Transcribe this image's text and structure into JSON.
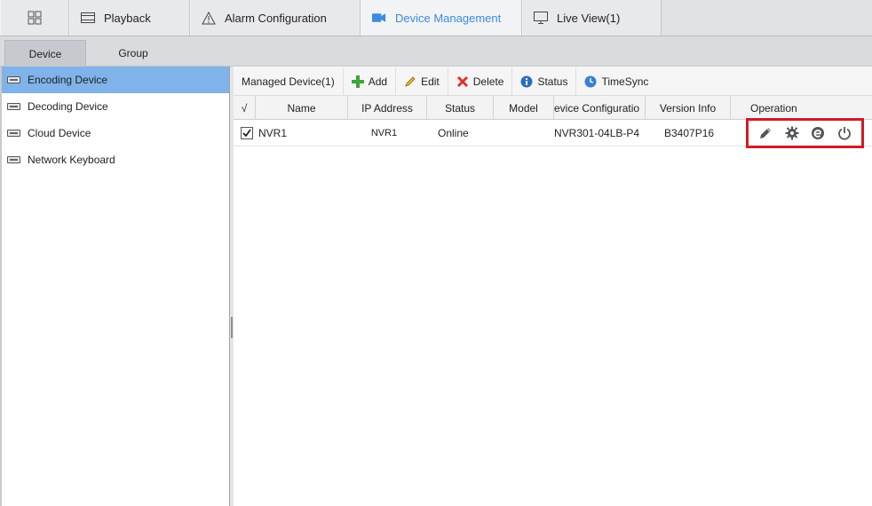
{
  "top_tabs": [
    {
      "label": "",
      "icon": "grid-icon"
    },
    {
      "label": "Playback",
      "icon": "playback-icon"
    },
    {
      "label": "Alarm Configuration",
      "icon": "alarm-icon"
    },
    {
      "label": "Device Management",
      "icon": "camera-icon",
      "active": true
    },
    {
      "label": "Live View(1)",
      "icon": "monitor-icon"
    }
  ],
  "sub_tabs": [
    {
      "label": "Device",
      "active": true
    },
    {
      "label": "Group"
    }
  ],
  "left_tree": [
    {
      "label": "Encoding Device",
      "selected": true
    },
    {
      "label": "Decoding Device"
    },
    {
      "label": "Cloud Device"
    },
    {
      "label": "Network Keyboard"
    }
  ],
  "toolbar": {
    "managed": "Managed Device(1)",
    "add": "Add",
    "edit": "Edit",
    "delete": "Delete",
    "status": "Status",
    "timesync": "TimeSync"
  },
  "table": {
    "headers": [
      "√",
      "Name",
      "IP Address",
      "Status",
      "Model",
      "evice Configuratio",
      "Version Info",
      "Operation"
    ],
    "rows": [
      {
        "checked": true,
        "name": "NVR1",
        "ip": "NVR1",
        "status": "Online",
        "model": "",
        "config": "NVR301-04LB-P4",
        "version": "B3407P16"
      }
    ]
  },
  "operations": [
    "edit-pencil-icon",
    "settings-gear-icon",
    "browser-e-icon",
    "power-icon"
  ],
  "colors": {
    "accent": "#3d8ae0",
    "selection": "#7fb3ea",
    "highlight_box": "#d21a24",
    "add_green": "#3aa53a",
    "delete_red": "#d9342b",
    "info_blue": "#2a6fbf"
  }
}
